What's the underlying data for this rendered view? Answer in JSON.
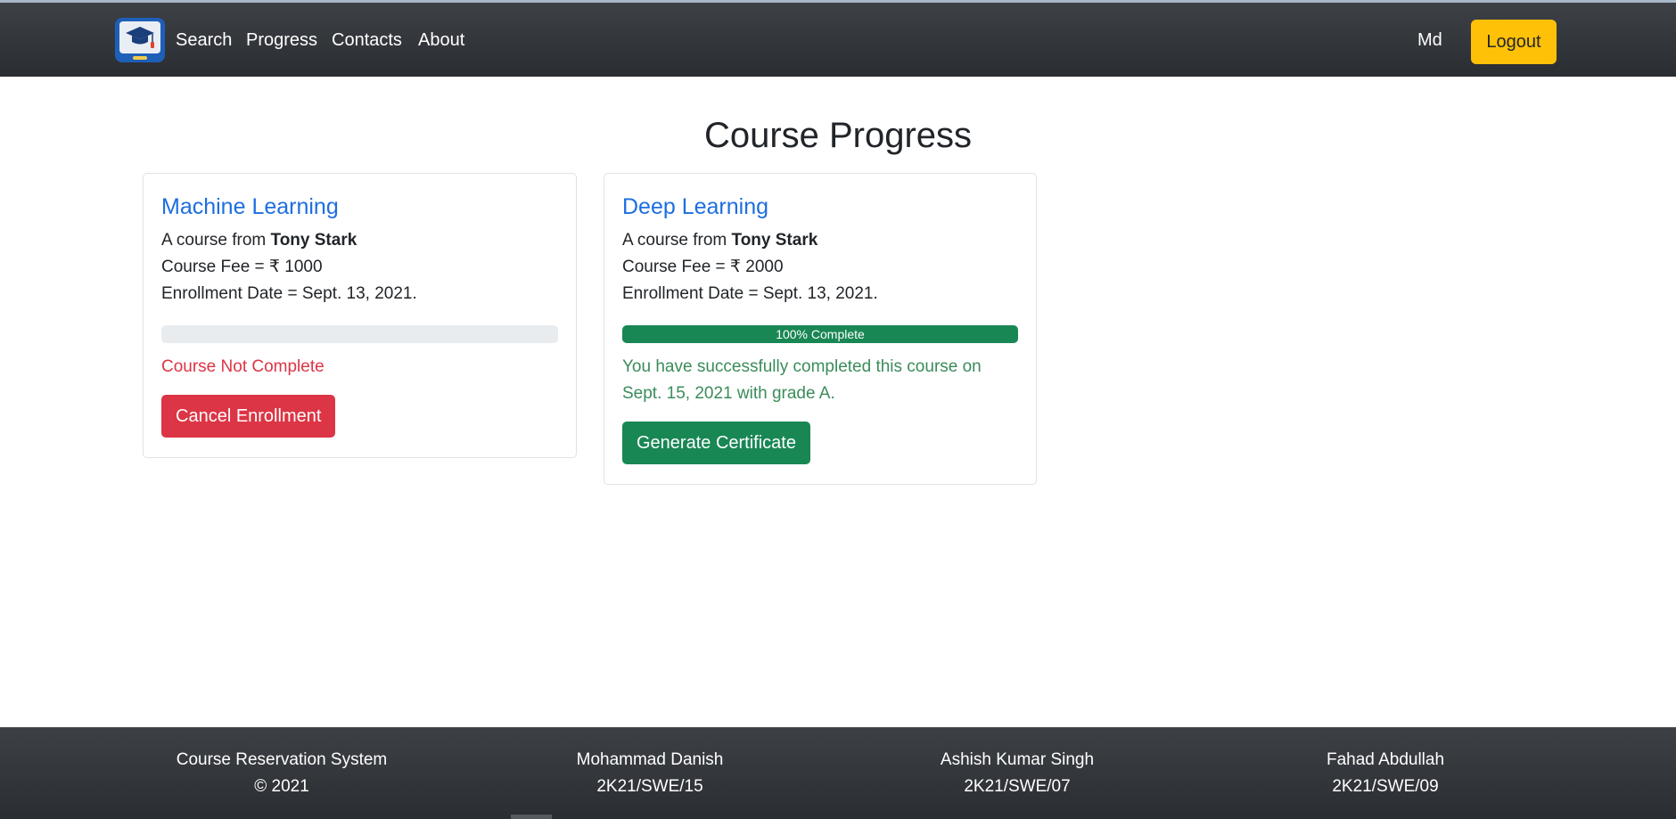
{
  "navbar": {
    "links": [
      "Search",
      "Progress",
      "Contacts",
      "About"
    ],
    "user": "Md",
    "logout_label": "Logout"
  },
  "page": {
    "title": "Course Progress"
  },
  "courses": [
    {
      "title": "Machine Learning",
      "from_prefix": "A course from",
      "instructor": "Tony Stark",
      "fee": "Course Fee = ₹ 1000",
      "enrollment": "Enrollment Date = Sept. 13, 2021.",
      "progress_percent": 0,
      "progress_label": "",
      "status": "Course Not Complete",
      "action_label": "Cancel Enrollment"
    },
    {
      "title": "Deep Learning",
      "from_prefix": "A course from",
      "instructor": "Tony Stark",
      "fee": "Course Fee = ₹ 2000",
      "enrollment": "Enrollment Date = Sept. 13, 2021.",
      "progress_percent": 100,
      "progress_label": "100% Complete",
      "status": "You have successfully completed this course on Sept. 15, 2021 with grade A.",
      "action_label": "Generate Certificate"
    }
  ],
  "footer": {
    "columns": [
      {
        "line1": "Course Reservation System",
        "line2": "© 2021"
      },
      {
        "line1": "Mohammad Danish",
        "line2": "2K21/SWE/15"
      },
      {
        "line1": "Ashish Kumar Singh",
        "line2": "2K21/SWE/07"
      },
      {
        "line1": "Fahad Abdullah",
        "line2": "2K21/SWE/09"
      }
    ]
  },
  "colors": {
    "navbar": "#343a40",
    "logout": "#ffc107",
    "link_title": "#1d6ee0",
    "danger": "#dc3545",
    "success": "#198754"
  },
  "icons": {
    "brand": "graduation-cap-laptop-icon"
  }
}
